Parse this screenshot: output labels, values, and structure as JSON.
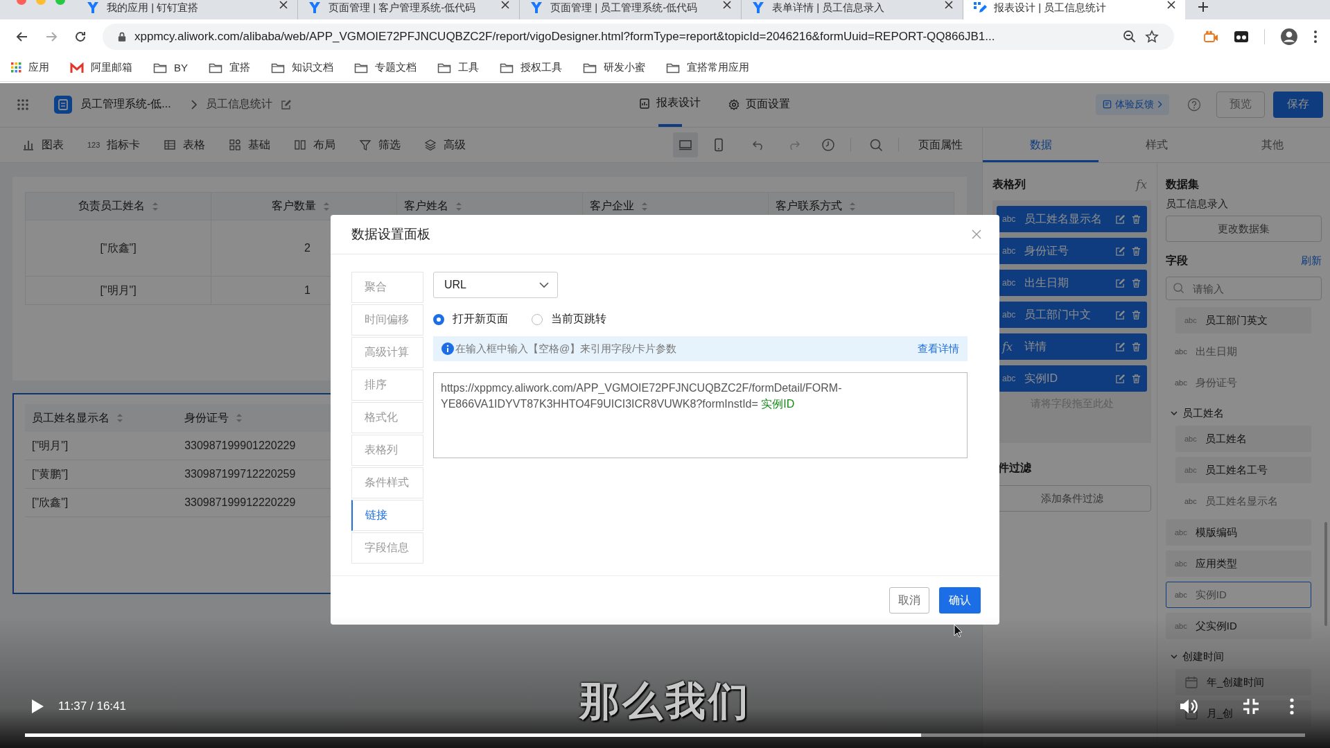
{
  "browser": {
    "tabs": [
      {
        "title": "我的应用 | 钉钉宜搭",
        "selected": false
      },
      {
        "title": "页面管理 | 客户管理系统-低代码",
        "selected": false
      },
      {
        "title": "页面管理 | 员工管理系统-低代码",
        "selected": false
      },
      {
        "title": "表单详情 | 员工信息录入",
        "selected": false
      },
      {
        "title": "报表设计 | 员工信息统计",
        "selected": true
      }
    ],
    "url": "xppmcy.aliwork.com/alibaba/web/APP_VGMOIE72PFJNCUQBZC2F/report/vigoDesigner.html?formType=report&topicId=2046216&formUuid=REPORT-QQ866JB1...",
    "bookmarks": [
      {
        "kind": "apps",
        "label": "应用"
      },
      {
        "kind": "mail",
        "label": "阿里邮箱"
      },
      {
        "kind": "folder",
        "label": "BY"
      },
      {
        "kind": "folder",
        "label": "宜搭"
      },
      {
        "kind": "folder",
        "label": "知识文档"
      },
      {
        "kind": "folder",
        "label": "专题文档"
      },
      {
        "kind": "folder",
        "label": "工具"
      },
      {
        "kind": "folder",
        "label": "授权工具"
      },
      {
        "kind": "folder",
        "label": "研发小蜜"
      },
      {
        "kind": "folder",
        "label": "宜搭常用应用"
      }
    ]
  },
  "header": {
    "app_name": "员工管理系统-低...",
    "page_name": "员工信息统计",
    "tabs": [
      {
        "kind": "report",
        "label": "报表设计",
        "selected": true
      },
      {
        "kind": "settings",
        "label": "页面设置",
        "selected": false
      }
    ],
    "feedback": "体验反馈",
    "preview": "预览",
    "save": "保存"
  },
  "toolbar": {
    "items": [
      {
        "kind": "chart",
        "label": "图表"
      },
      {
        "kind": "metric",
        "icon_text": "123",
        "label": "指标卡"
      },
      {
        "kind": "table",
        "label": "表格"
      },
      {
        "kind": "basic",
        "label": "基础"
      },
      {
        "kind": "layout",
        "label": "布局"
      },
      {
        "kind": "filter",
        "label": "筛选"
      },
      {
        "kind": "advanced",
        "label": "高级"
      }
    ],
    "devices": [
      {
        "kind": "desktop",
        "selected": true
      },
      {
        "kind": "mobile",
        "selected": false
      }
    ],
    "page_props": "页面属性"
  },
  "canvas": {
    "tables": [
      {
        "selected": false,
        "columns": [
          "负责员工姓名",
          "客户数量",
          "客户姓名",
          "客户企业",
          "客户联系方式"
        ],
        "rows": [
          [
            "[\"欣鑫\"]",
            "2"
          ],
          [
            "[\"明月\"]",
            "1"
          ]
        ]
      },
      {
        "selected": true,
        "columns": [
          "员工姓名显示名",
          "身份证号"
        ],
        "rows": [
          [
            "[\"明月\"]",
            "330987199901220229"
          ],
          [
            "[\"黄鹏\"]",
            "330987199712220259"
          ],
          [
            "[\"欣鑫\"]",
            "330987199912220229"
          ]
        ]
      }
    ]
  },
  "panel": {
    "tabs": [
      {
        "label": "数据",
        "selected": true
      },
      {
        "label": "样式",
        "selected": false
      },
      {
        "label": "其他",
        "selected": false
      }
    ],
    "columns_title": "表格列",
    "formula_button": "fx",
    "columns": [
      {
        "kind": "text",
        "type": "abc",
        "label": "员工姓名显示名"
      },
      {
        "kind": "text",
        "type": "abc",
        "label": "身份证号"
      },
      {
        "kind": "text",
        "type": "abc",
        "label": "出生日期"
      },
      {
        "kind": "text",
        "type": "abc",
        "label": "员工部门中文"
      },
      {
        "kind": "formula",
        "type": "fx",
        "label": "详情"
      },
      {
        "kind": "text",
        "type": "abc",
        "label": "实例ID"
      }
    ],
    "drop_hint": "请将字段拖至此处",
    "filter_title": "件过滤",
    "add_filter": "添加条件过滤",
    "dataset_title": "数据集",
    "dataset_name": "员工信息录入",
    "change_dataset": "更改数据集",
    "fields_title": "字段",
    "refresh": "刷新",
    "search_placeholder": "请输入",
    "fields": [
      {
        "kind": "group",
        "children": [
          {
            "kind": "text",
            "type": "abc",
            "label": "员工部门英文",
            "disabled": false,
            "selected": false
          }
        ]
      },
      {
        "kind": "text",
        "type": "abc",
        "label": "出生日期",
        "disabled": true,
        "selected": false
      },
      {
        "kind": "text",
        "type": "abc",
        "label": "身份证号",
        "disabled": true,
        "selected": false
      },
      {
        "kind": "group",
        "label": "员工姓名",
        "expanded": true,
        "children": [
          {
            "kind": "text",
            "type": "abc",
            "label": "员工姓名",
            "disabled": false,
            "selected": false
          },
          {
            "kind": "text",
            "type": "abc",
            "label": "员工姓名工号",
            "disabled": false,
            "selected": false
          },
          {
            "kind": "text",
            "type": "abc",
            "label": "员工姓名显示名",
            "disabled": true,
            "selected": false
          }
        ]
      },
      {
        "kind": "text",
        "type": "abc",
        "label": "模版编码",
        "disabled": false,
        "selected": false
      },
      {
        "kind": "text",
        "type": "abc",
        "label": "应用类型",
        "disabled": false,
        "selected": false
      },
      {
        "kind": "text",
        "type": "abc",
        "label": "实例ID",
        "disabled": true,
        "selected": true
      },
      {
        "kind": "text",
        "type": "abc",
        "label": "父实例ID",
        "disabled": false,
        "selected": false
      },
      {
        "kind": "group",
        "label": "创建时间",
        "expanded": true,
        "children": [
          {
            "kind": "date",
            "label": "年_创建时间",
            "disabled": false,
            "selected": false
          },
          {
            "kind": "date",
            "label": "月_创",
            "disabled": false,
            "selected": false
          }
        ]
      }
    ]
  },
  "dialog": {
    "title": "数据设置面板",
    "nav": [
      {
        "label": "聚合",
        "selected": false
      },
      {
        "label": "时间偏移",
        "selected": false
      },
      {
        "label": "高级计算",
        "selected": false
      },
      {
        "label": "排序",
        "selected": false
      },
      {
        "label": "格式化",
        "selected": false
      },
      {
        "label": "表格列",
        "selected": false
      },
      {
        "label": "条件样式",
        "selected": false
      },
      {
        "label": "链接",
        "selected": true
      },
      {
        "label": "字段信息",
        "selected": false
      }
    ],
    "link_type": "URL",
    "open_modes": [
      {
        "label": "打开新页面",
        "selected": true
      },
      {
        "label": "当前页跳转",
        "selected": false
      }
    ],
    "hint": "在输入框中输入【空格@】来引用字段/卡片参数",
    "hint_link": "查看详情",
    "url_text": "https://xppmcy.aliwork.com/APP_VGMOIE72PFJNCUQBZC2F/formDetail/FORM-YE866VA1IDYVT87K3HHTO4F9UICI3ICR8VUWK8?formInstId=",
    "url_field": "实例ID",
    "cancel": "取消",
    "confirm": "确认"
  },
  "video": {
    "paused": true,
    "time": "11:37 / 16:41",
    "subtitle": "那么我们",
    "level": 0.7
  }
}
